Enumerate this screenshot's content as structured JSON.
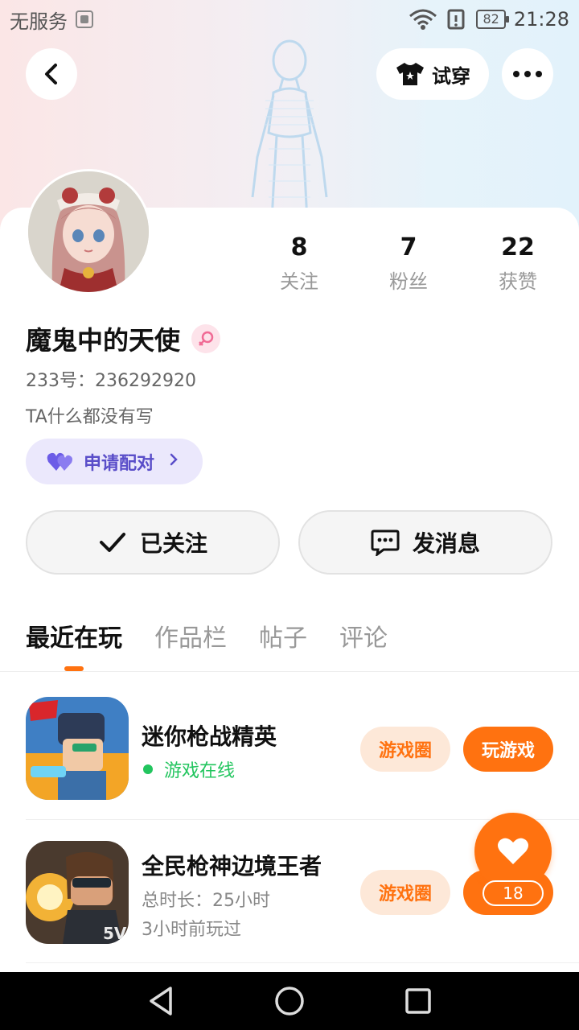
{
  "status_bar": {
    "carrier": "无服务",
    "battery": "82",
    "time": "21:28"
  },
  "header": {
    "try_on_label": "试穿",
    "back_icon": "chevron-left-icon",
    "more_icon": "more-dots-icon",
    "try_on_icon": "tshirt-icon"
  },
  "profile": {
    "name": "魔鬼中的天使",
    "gender_icon": "female-icon",
    "uid": "233号：236292920",
    "bio": "TA什么都没有写",
    "match_label": "申请配对",
    "stats": [
      {
        "value": "8",
        "label": "关注"
      },
      {
        "value": "7",
        "label": "粉丝"
      },
      {
        "value": "22",
        "label": "获赞"
      }
    ],
    "follow_label": "已关注",
    "message_label": "发消息"
  },
  "tabs": [
    {
      "label": "最近在玩",
      "active": true
    },
    {
      "label": "作品栏",
      "active": false
    },
    {
      "label": "帖子",
      "active": false
    },
    {
      "label": "评论",
      "active": false
    }
  ],
  "games": [
    {
      "name": "迷你枪战精英",
      "status": "游戏在线",
      "circle_label": "游戏圈",
      "play_label": "玩游戏"
    },
    {
      "name": "全民枪神边境王者",
      "duration": "总时长：25小时",
      "last_played": "3小时前玩过",
      "circle_label": "游戏圈"
    }
  ],
  "fab": {
    "icon": "heart-icon",
    "count": "18"
  },
  "colors": {
    "accent": "#ff7210",
    "online": "#22c55e",
    "match": "#5a4ec9"
  }
}
